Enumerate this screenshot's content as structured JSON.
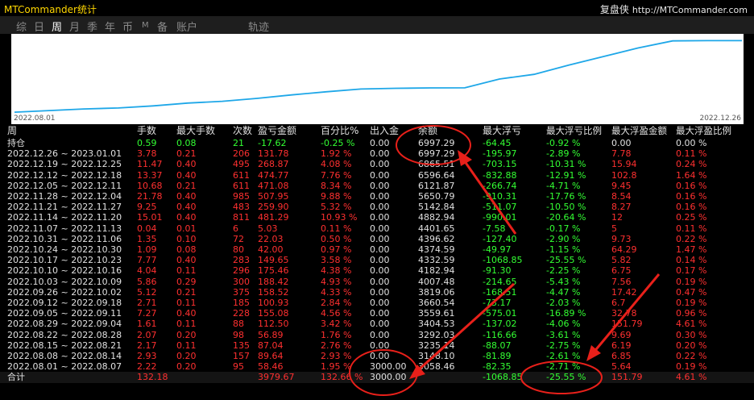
{
  "window": {
    "title": "MTCommander统计",
    "brand_cn": "复盘侠",
    "brand_url": "http://MTCommander.com"
  },
  "tabs": [
    {
      "label": "综",
      "active": false
    },
    {
      "label": "日",
      "active": false
    },
    {
      "label": "周",
      "active": true
    },
    {
      "label": "月",
      "active": false
    },
    {
      "label": "季",
      "active": false
    },
    {
      "label": "年",
      "active": false
    },
    {
      "label": "币",
      "active": false
    },
    {
      "label": "M",
      "active": false
    },
    {
      "label": "备",
      "active": false
    },
    {
      "label": "账户",
      "active": false
    },
    {
      "label": "轨迹",
      "active": false
    }
  ],
  "chart": {
    "date_start": "2022.08.01",
    "date_end": "2022.12.26",
    "line_color": "#1ea7e8"
  },
  "chart_data": {
    "type": "line",
    "x": [
      "2022.08.01",
      "2022.08.08",
      "2022.08.15",
      "2022.08.22",
      "2022.08.29",
      "2022.09.05",
      "2022.09.12",
      "2022.09.19",
      "2022.09.26",
      "2022.10.03",
      "2022.10.10",
      "2022.10.17",
      "2022.10.24",
      "2022.10.31",
      "2022.11.07",
      "2022.11.14",
      "2022.11.21",
      "2022.11.28",
      "2022.12.05",
      "2022.12.12",
      "2022.12.19",
      "2022.12.26"
    ],
    "values": [
      3058.46,
      3148.1,
      3235.14,
      3292.03,
      3404.53,
      3559.61,
      3660.54,
      3819.06,
      4007.48,
      4182.94,
      4332.59,
      4374.59,
      4396.62,
      4401.65,
      4882.94,
      5142.84,
      5650.79,
      6121.87,
      6596.64,
      6985.51,
      6997.29,
      6997.29
    ]
  },
  "table": {
    "headers": {
      "period": "周",
      "lots": "手数",
      "maxlots": "最大手数",
      "count": "次数",
      "pl": "盈亏金额",
      "pct": "百分比%",
      "dep": "出入金",
      "bal": "余额",
      "maxfl": "最大浮亏",
      "maxflpct": "最大浮亏比例",
      "maxfp": "最大浮盈金额",
      "maxfppct": "最大浮盈比例"
    },
    "holding": {
      "period": "持仓",
      "lots": "0.59",
      "maxlots": "0.08",
      "count": "21",
      "pl": "-17.62",
      "pct": "-0.25 %",
      "dep": "0.00",
      "bal": "6997.29",
      "maxfl": "-64.45",
      "maxflpct": "-0.92 %",
      "maxfp": "0.00",
      "maxfppct": "0.00 %"
    },
    "rows": [
      {
        "period": "2022.12.26 ~ 2023.01.01",
        "lots": "3.78",
        "maxlots": "0.21",
        "count": "206",
        "pl": "131.78",
        "pct": "1.92 %",
        "dep": "0.00",
        "bal": "6997.29",
        "maxfl": "-195.97",
        "maxflpct": "-2.89 %",
        "maxfp": "7.78",
        "maxfppct": "0.11 %"
      },
      {
        "period": "2022.12.19 ~ 2022.12.25",
        "lots": "11.47",
        "maxlots": "0.40",
        "count": "495",
        "pl": "268.87",
        "pct": "4.08 %",
        "dep": "0.00",
        "bal": "6865.51",
        "maxfl": "-703.15",
        "maxflpct": "-10.31 %",
        "maxfp": "15.94",
        "maxfppct": "0.24 %"
      },
      {
        "period": "2022.12.12 ~ 2022.12.18",
        "lots": "13.37",
        "maxlots": "0.40",
        "count": "611",
        "pl": "474.77",
        "pct": "7.76 %",
        "dep": "0.00",
        "bal": "6596.64",
        "maxfl": "-832.88",
        "maxflpct": "-12.91 %",
        "maxfp": "102.8",
        "maxfppct": "1.64 %"
      },
      {
        "period": "2022.12.05 ~ 2022.12.11",
        "lots": "10.68",
        "maxlots": "0.21",
        "count": "611",
        "pl": "471.08",
        "pct": "8.34 %",
        "dep": "0.00",
        "bal": "6121.87",
        "maxfl": "-266.74",
        "maxflpct": "-4.71 %",
        "maxfp": "9.45",
        "maxfppct": "0.16 %"
      },
      {
        "period": "2022.11.28 ~ 2022.12.04",
        "lots": "21.78",
        "maxlots": "0.40",
        "count": "985",
        "pl": "507.95",
        "pct": "9.88 %",
        "dep": "0.00",
        "bal": "5650.79",
        "maxfl": "-910.31",
        "maxflpct": "-17.76 %",
        "maxfp": "8.54",
        "maxfppct": "0.16 %"
      },
      {
        "period": "2022.11.21 ~ 2022.11.27",
        "lots": "9.25",
        "maxlots": "0.40",
        "count": "483",
        "pl": "259.90",
        "pct": "5.32 %",
        "dep": "0.00",
        "bal": "5142.84",
        "maxfl": "-511.07",
        "maxflpct": "-10.50 %",
        "maxfp": "8.27",
        "maxfppct": "0.16 %"
      },
      {
        "period": "2022.11.14 ~ 2022.11.20",
        "lots": "15.01",
        "maxlots": "0.40",
        "count": "811",
        "pl": "481.29",
        "pct": "10.93 %",
        "dep": "0.00",
        "bal": "4882.94",
        "maxfl": "-990.01",
        "maxflpct": "-20.64 %",
        "maxfp": "12",
        "maxfppct": "0.25 %"
      },
      {
        "period": "2022.11.07 ~ 2022.11.13",
        "lots": "0.04",
        "maxlots": "0.01",
        "count": "6",
        "pl": "5.03",
        "pct": "0.11 %",
        "dep": "0.00",
        "bal": "4401.65",
        "maxfl": "-7.58",
        "maxflpct": "-0.17 %",
        "maxfp": "5",
        "maxfppct": "0.11 %"
      },
      {
        "period": "2022.10.31 ~ 2022.11.06",
        "lots": "1.35",
        "maxlots": "0.10",
        "count": "72",
        "pl": "22.03",
        "pct": "0.50 %",
        "dep": "0.00",
        "bal": "4396.62",
        "maxfl": "-127.40",
        "maxflpct": "-2.90 %",
        "maxfp": "9.73",
        "maxfppct": "0.22 %"
      },
      {
        "period": "2022.10.24 ~ 2022.10.30",
        "lots": "1.09",
        "maxlots": "0.08",
        "count": "80",
        "pl": "42.00",
        "pct": "0.97 %",
        "dep": "0.00",
        "bal": "4374.59",
        "maxfl": "-49.97",
        "maxflpct": "-1.15 %",
        "maxfp": "64.29",
        "maxfppct": "1.47 %"
      },
      {
        "period": "2022.10.17 ~ 2022.10.23",
        "lots": "7.77",
        "maxlots": "0.40",
        "count": "283",
        "pl": "149.65",
        "pct": "3.58 %",
        "dep": "0.00",
        "bal": "4332.59",
        "maxfl": "-1068.85",
        "maxflpct": "-25.55 %",
        "maxfp": "5.82",
        "maxfppct": "0.14 %"
      },
      {
        "period": "2022.10.10 ~ 2022.10.16",
        "lots": "4.04",
        "maxlots": "0.11",
        "count": "296",
        "pl": "175.46",
        "pct": "4.38 %",
        "dep": "0.00",
        "bal": "4182.94",
        "maxfl": "-91.30",
        "maxflpct": "-2.25 %",
        "maxfp": "6.75",
        "maxfppct": "0.17 %"
      },
      {
        "period": "2022.10.03 ~ 2022.10.09",
        "lots": "5.86",
        "maxlots": "0.29",
        "count": "300",
        "pl": "188.42",
        "pct": "4.93 %",
        "dep": "0.00",
        "bal": "4007.48",
        "maxfl": "-214.65",
        "maxflpct": "-5.43 %",
        "maxfp": "7.56",
        "maxfppct": "0.19 %"
      },
      {
        "period": "2022.09.26 ~ 2022.10.02",
        "lots": "5.12",
        "maxlots": "0.21",
        "count": "375",
        "pl": "158.52",
        "pct": "4.33 %",
        "dep": "0.00",
        "bal": "3819.06",
        "maxfl": "-168.51",
        "maxflpct": "-4.47 %",
        "maxfp": "17.42",
        "maxfppct": "0.47 %"
      },
      {
        "period": "2022.09.12 ~ 2022.09.18",
        "lots": "2.71",
        "maxlots": "0.11",
        "count": "185",
        "pl": "100.93",
        "pct": "2.84 %",
        "dep": "0.00",
        "bal": "3660.54",
        "maxfl": "-73.17",
        "maxflpct": "-2.03 %",
        "maxfp": "6.7",
        "maxfppct": "0.19 %"
      },
      {
        "period": "2022.09.05 ~ 2022.09.11",
        "lots": "7.27",
        "maxlots": "0.40",
        "count": "228",
        "pl": "155.08",
        "pct": "4.56 %",
        "dep": "0.00",
        "bal": "3559.61",
        "maxfl": "-575.01",
        "maxflpct": "-16.89 %",
        "maxfp": "32.78",
        "maxfppct": "0.96 %"
      },
      {
        "period": "2022.08.29 ~ 2022.09.04",
        "lots": "1.61",
        "maxlots": "0.11",
        "count": "88",
        "pl": "112.50",
        "pct": "3.42 %",
        "dep": "0.00",
        "bal": "3404.53",
        "maxfl": "-137.02",
        "maxflpct": "-4.06 %",
        "maxfp": "151.79",
        "maxfppct": "4.61 %"
      },
      {
        "period": "2022.08.22 ~ 2022.08.28",
        "lots": "2.07",
        "maxlots": "0.20",
        "count": "98",
        "pl": "56.89",
        "pct": "1.76 %",
        "dep": "0.00",
        "bal": "3292.03",
        "maxfl": "-116.66",
        "maxflpct": "-3.61 %",
        "maxfp": "9.69",
        "maxfppct": "0.30 %"
      },
      {
        "period": "2022.08.15 ~ 2022.08.21",
        "lots": "2.17",
        "maxlots": "0.11",
        "count": "135",
        "pl": "87.04",
        "pct": "2.76 %",
        "dep": "0.00",
        "bal": "3235.14",
        "maxfl": "-88.07",
        "maxflpct": "-2.75 %",
        "maxfp": "6.19",
        "maxfppct": "0.20 %"
      },
      {
        "period": "2022.08.08 ~ 2022.08.14",
        "lots": "2.93",
        "maxlots": "0.20",
        "count": "157",
        "pl": "89.64",
        "pct": "2.93 %",
        "dep": "0.00",
        "bal": "3148.10",
        "maxfl": "-81.89",
        "maxflpct": "-2.61 %",
        "maxfp": "6.85",
        "maxfppct": "0.22 %"
      },
      {
        "period": "2022.08.01 ~ 2022.08.07",
        "lots": "2.22",
        "maxlots": "0.20",
        "count": "95",
        "pl": "58.46",
        "pct": "1.95 %",
        "dep": "3000.00",
        "bal": "3058.46",
        "maxfl": "-82.35",
        "maxflpct": "-2.71 %",
        "maxfp": "5.64",
        "maxfppct": "0.19 %"
      }
    ],
    "total": {
      "period": "合计",
      "lots": "132.18",
      "maxlots": "",
      "count": "",
      "pl": "3979.67",
      "pct": "132.66 %",
      "dep": "3000.00",
      "bal": "",
      "maxfl": "-1068.85",
      "maxflpct": "-25.55 %",
      "maxfp": "151.79",
      "maxfppct": "4.61 %"
    }
  },
  "colors": {
    "positive": "#ff3030",
    "negative": "#33ff33",
    "annotation": "#e8201a"
  }
}
